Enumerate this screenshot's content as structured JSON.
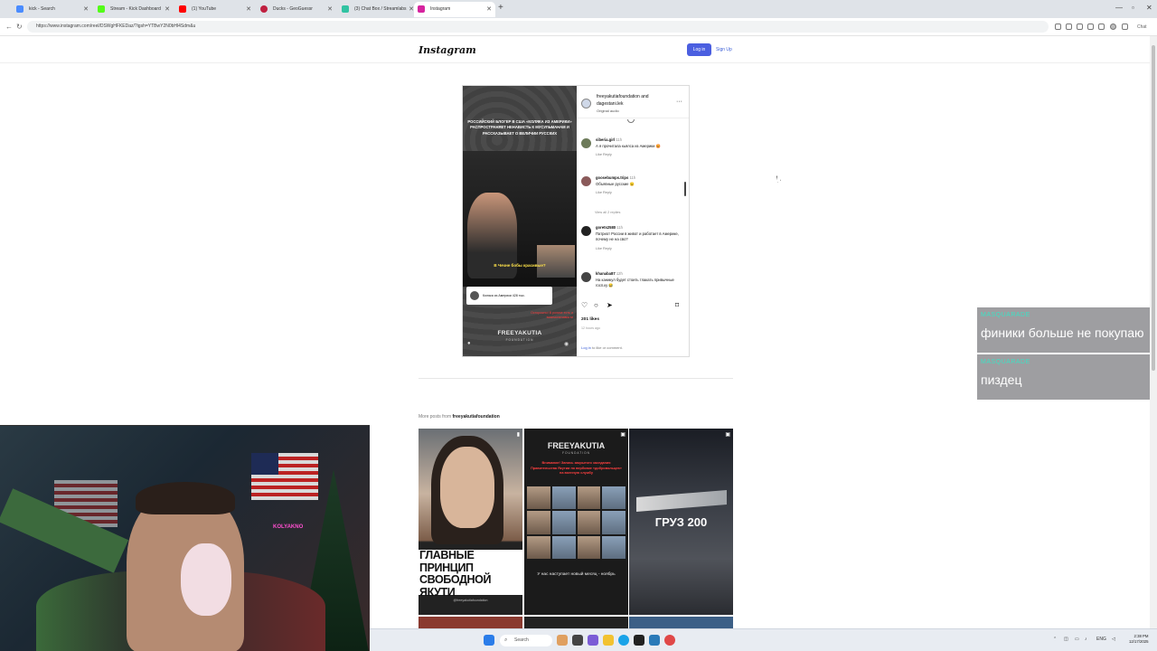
{
  "browser": {
    "tabs": [
      {
        "label": "kick - Search",
        "color": "#4a8cff"
      },
      {
        "label": "Stream - Kick Dashboard",
        "color": "#53fc18"
      },
      {
        "label": "(1) YouTube",
        "color": "#ff0000"
      },
      {
        "label": "Ducks - GeoGuessr",
        "color": "#c02040"
      },
      {
        "label": "(3) Chat Box / Streamlabs",
        "color": "#31c3a2"
      },
      {
        "label": "Instagram",
        "color": "#d6249f"
      }
    ],
    "url": "https://www.instagram.com/reel/DSWgHFKEDaz/?igsh=YTBwY2N0bHl4Sdm&u",
    "profile_label": "Chat"
  },
  "instagram": {
    "logo": "Instagram",
    "login": "Log in",
    "signup": "Sign Up",
    "post": {
      "headline": "Российский блогер в США «Коляка из Америки» распространяет ненависть к мусульманам и рассказывает о величии русских",
      "video_caption": "В Чечне бобы красивые?",
      "profile_bar": "Коляка из Америки  428 тыс.",
      "warning": "Осторожно! В ролике есть и взаимоненависти",
      "brand": "FREEYAKUTIA",
      "brand_sub": "FOUNDATION",
      "author_line1": "freeyakutiafoundation and",
      "author_line2": "dagestani.lek",
      "audio": "Original audio",
      "comments": [
        {
          "user": "siberia.girl",
          "time": "11h",
          "text": "А я прочитала кьялса из Америки 😡",
          "actions": "Like   Reply"
        },
        {
          "user": "goosebumps.trips",
          "time": "11h",
          "text": "Объявные русские 😉",
          "actions": "Like   Reply"
        },
        {
          "user": "gorets2580",
          "time": "11h",
          "text": "Патриот России в живот и работает в Америке, почему не на сво?",
          "actions": "Like   Reply"
        },
        {
          "user": "khanaba87",
          "time": "12h",
          "text": "На каникул будет стоить тлакать привычные госп.ку 😂",
          "actions": ""
        }
      ],
      "view_replies": "View all 2 replies",
      "likes": "201 likes",
      "ago": "12 hours ago",
      "login_prompt_link": "Log in",
      "login_prompt_rest": " to like or comment."
    },
    "more_posts_prefix": "More posts from ",
    "more_posts_user": "freeyakutiafoundation",
    "grid": {
      "g1_text": "ГЛАВНЫЕ ПРИНЦИП СВОБОДНОЙ ЯКУТИ",
      "g1_tag": "@freeyakutiafoundation",
      "g2_brand": "FREEYAKUTIA",
      "g2_sub": "FOUNDATION",
      "g2_red": "Внимание! Запись закрытого заседания Правительства Якутии по вербовке «добровольцев» на военную службу",
      "g2_note": "У нас наступает новый месяц - ноябрь",
      "g3_text": "ГРУЗ 200"
    }
  },
  "chat": [
    {
      "name": "MASQUARADE",
      "message": "финики больше не покупаю"
    },
    {
      "name": "MASQUARADE",
      "message": "пиздец"
    }
  ],
  "webcam": {
    "neon": "KOLYAKNO"
  },
  "taskbar": {
    "search": "Search",
    "lang": "ENG",
    "time": "2:38 PM",
    "date": "12/17/2025"
  }
}
